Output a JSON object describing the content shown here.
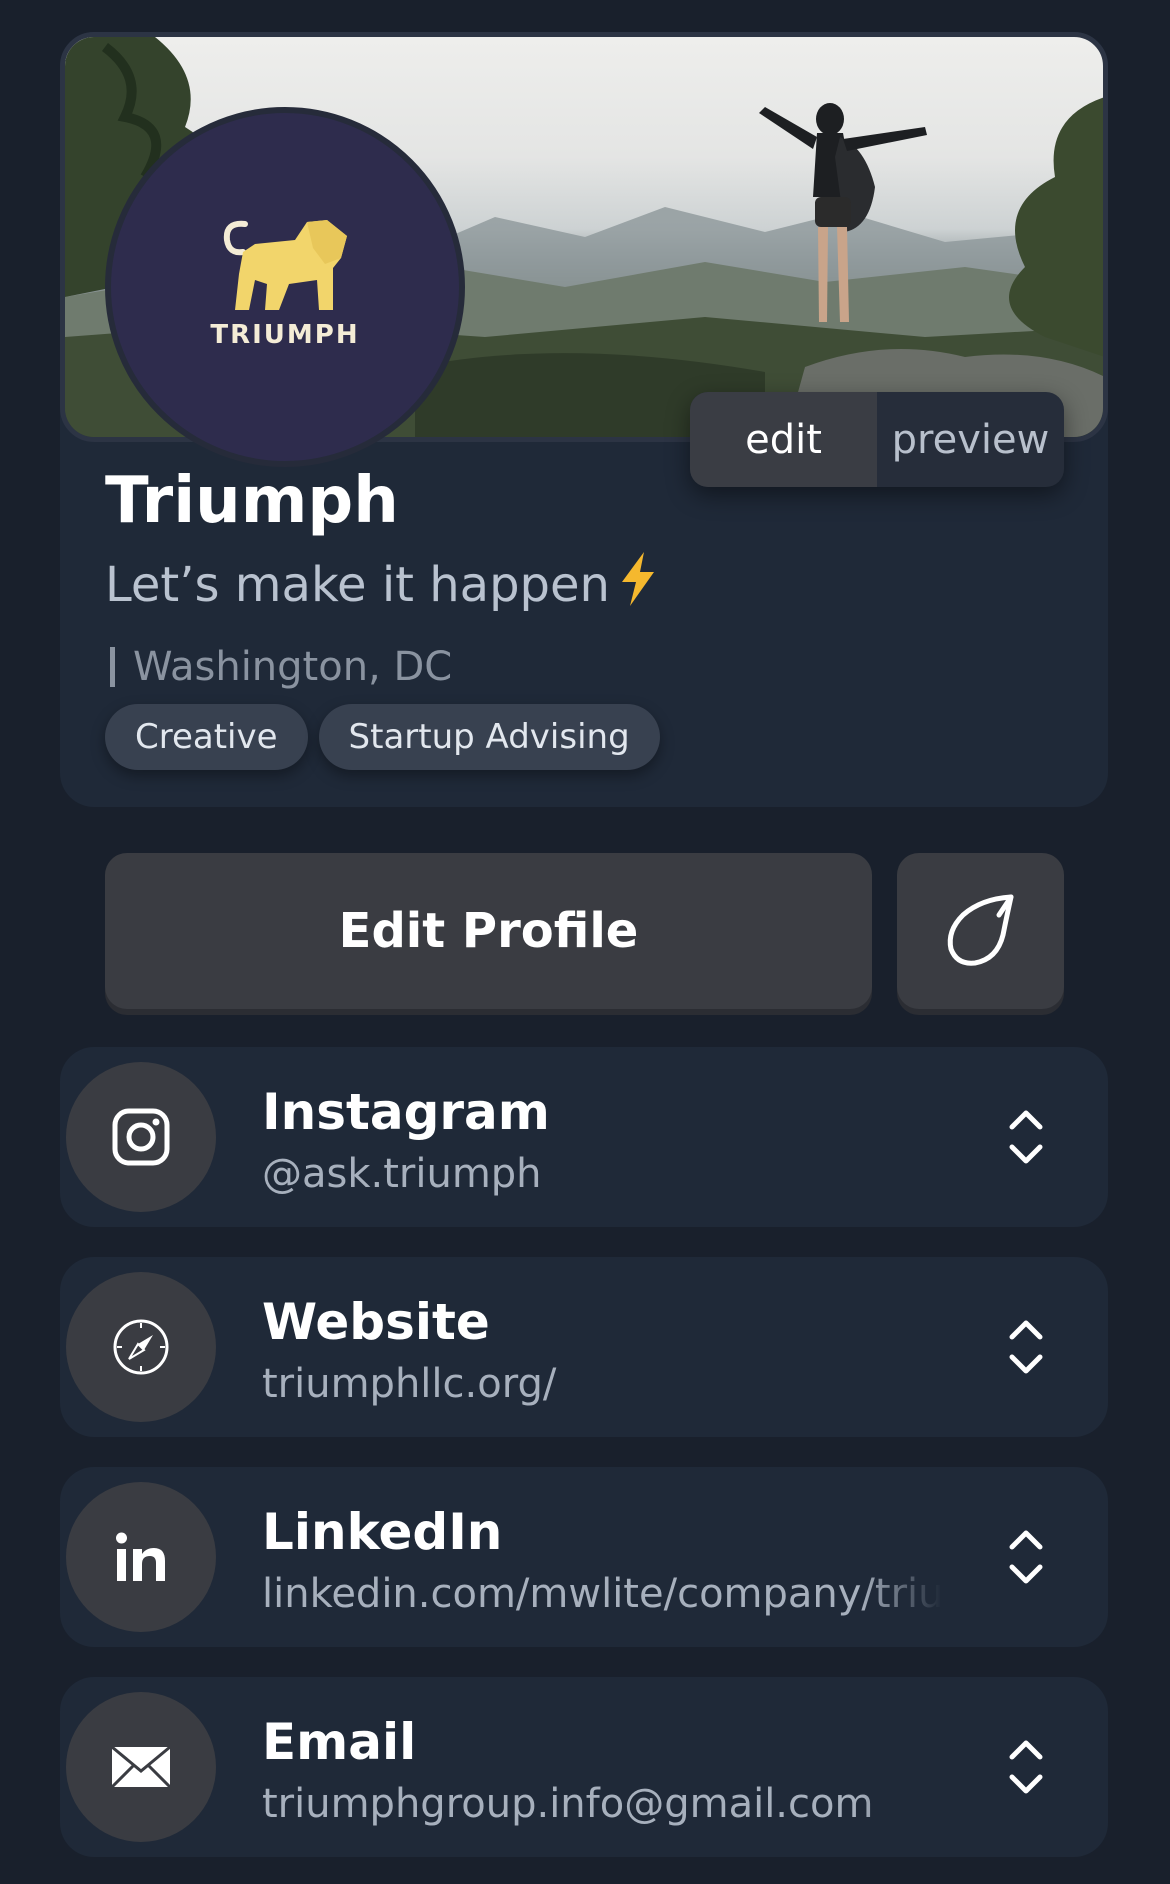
{
  "profile": {
    "logo_text": "TRIUMPH",
    "name": "Triumph",
    "tagline": "Let’s make it happen",
    "tagline_emoji": "⚡",
    "location": "Washington, DC",
    "tags": [
      "Creative",
      "Startup Advising"
    ]
  },
  "mode_toggle": {
    "edit_label": "edit",
    "preview_label": "preview",
    "selected": "edit"
  },
  "actions": {
    "edit_profile_label": "Edit Profile",
    "theme_icon": "leaf-icon"
  },
  "links": [
    {
      "title": "Instagram",
      "value": "@ask.triumph",
      "icon": "instagram-icon"
    },
    {
      "title": "Website",
      "value": "triumphllc.org/",
      "icon": "compass-icon"
    },
    {
      "title": "LinkedIn",
      "value": "linkedin.com/mwlite/company/triumph",
      "icon": "linkedin-icon"
    },
    {
      "title": "Email",
      "value": "triumphgroup.info@gmail.com",
      "icon": "envelope-icon"
    }
  ],
  "colors": {
    "background": "#19202c",
    "card": "#1f2938",
    "button": "#3a3c42",
    "logo_gold": "#f2d56b",
    "logo_bg": "#2e2c4d"
  }
}
